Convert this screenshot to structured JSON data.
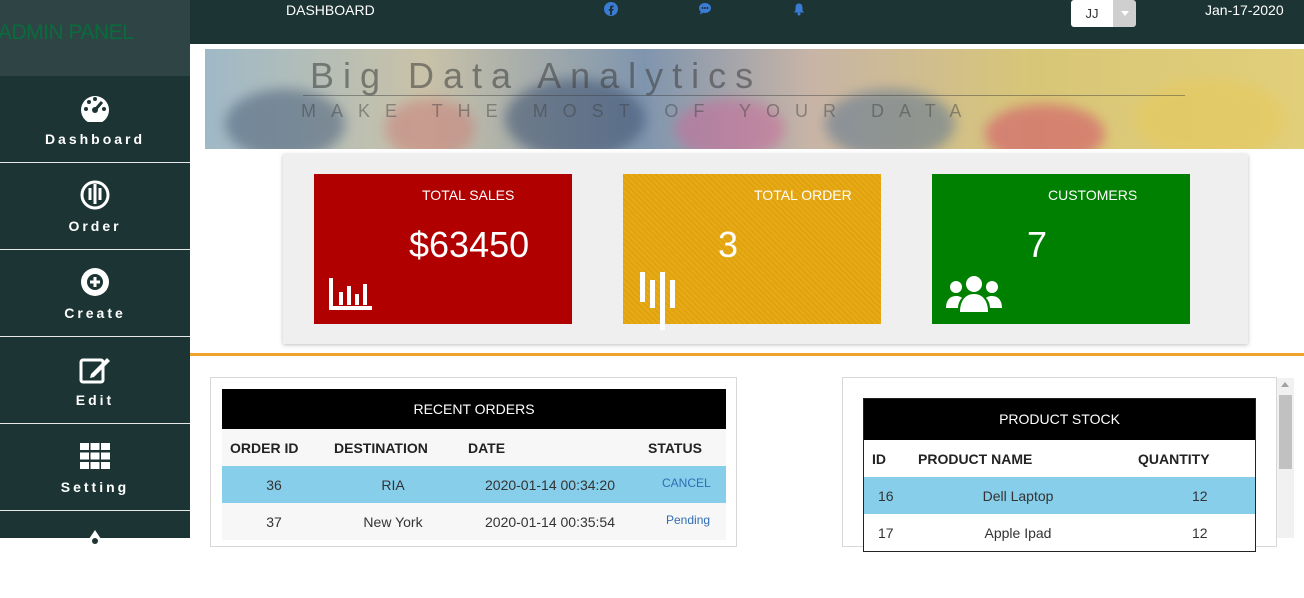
{
  "sidebar": {
    "brand": "ADMIN PANEL",
    "items": [
      {
        "label": "Dashboard",
        "icon": "gauge-icon"
      },
      {
        "label": "Order",
        "icon": "order-icon"
      },
      {
        "label": "Create",
        "icon": "create-icon"
      },
      {
        "label": "Edit",
        "icon": "edit-icon"
      },
      {
        "label": "Setting",
        "icon": "grid-icon"
      }
    ]
  },
  "topbar": {
    "title": "DASHBOARD",
    "user": "JJ",
    "date": "Jan-17-2020"
  },
  "banner": {
    "title": "Big Data Analytics",
    "subtitle": "MAKE THE MOST OF YOUR DATA"
  },
  "cards": {
    "sales": {
      "label": "TOTAL SALES",
      "value": "$63450"
    },
    "order": {
      "label": "TOTAL ORDER",
      "value": "3"
    },
    "customers": {
      "label": "CUSTOMERS",
      "value": "7"
    }
  },
  "recent_orders": {
    "title": "RECENT ORDERS",
    "columns": [
      "ORDER ID",
      "DESTINATION",
      "DATE",
      "STATUS"
    ],
    "rows": [
      {
        "id": "36",
        "destination": "RIA",
        "date": "2020-01-14 00:34:20",
        "status": "CANCEL"
      },
      {
        "id": "37",
        "destination": "New York",
        "date": "2020-01-14 00:35:54",
        "status": "Pending"
      }
    ]
  },
  "product_stock": {
    "title": "PRODUCT STOCK",
    "columns": [
      "ID",
      "PRODUCT NAME",
      "QUANTITY"
    ],
    "rows": [
      {
        "id": "16",
        "name": "Dell Laptop",
        "qty": "12"
      },
      {
        "id": "17",
        "name": "Apple Ipad",
        "qty": "12"
      }
    ]
  },
  "colors": {
    "sidebar": "#1c3434",
    "sales": "#b10000",
    "order": "#e0a20f",
    "customers": "#008000",
    "accent": "#f0a22a",
    "row_highlight": "#87ceeb"
  }
}
